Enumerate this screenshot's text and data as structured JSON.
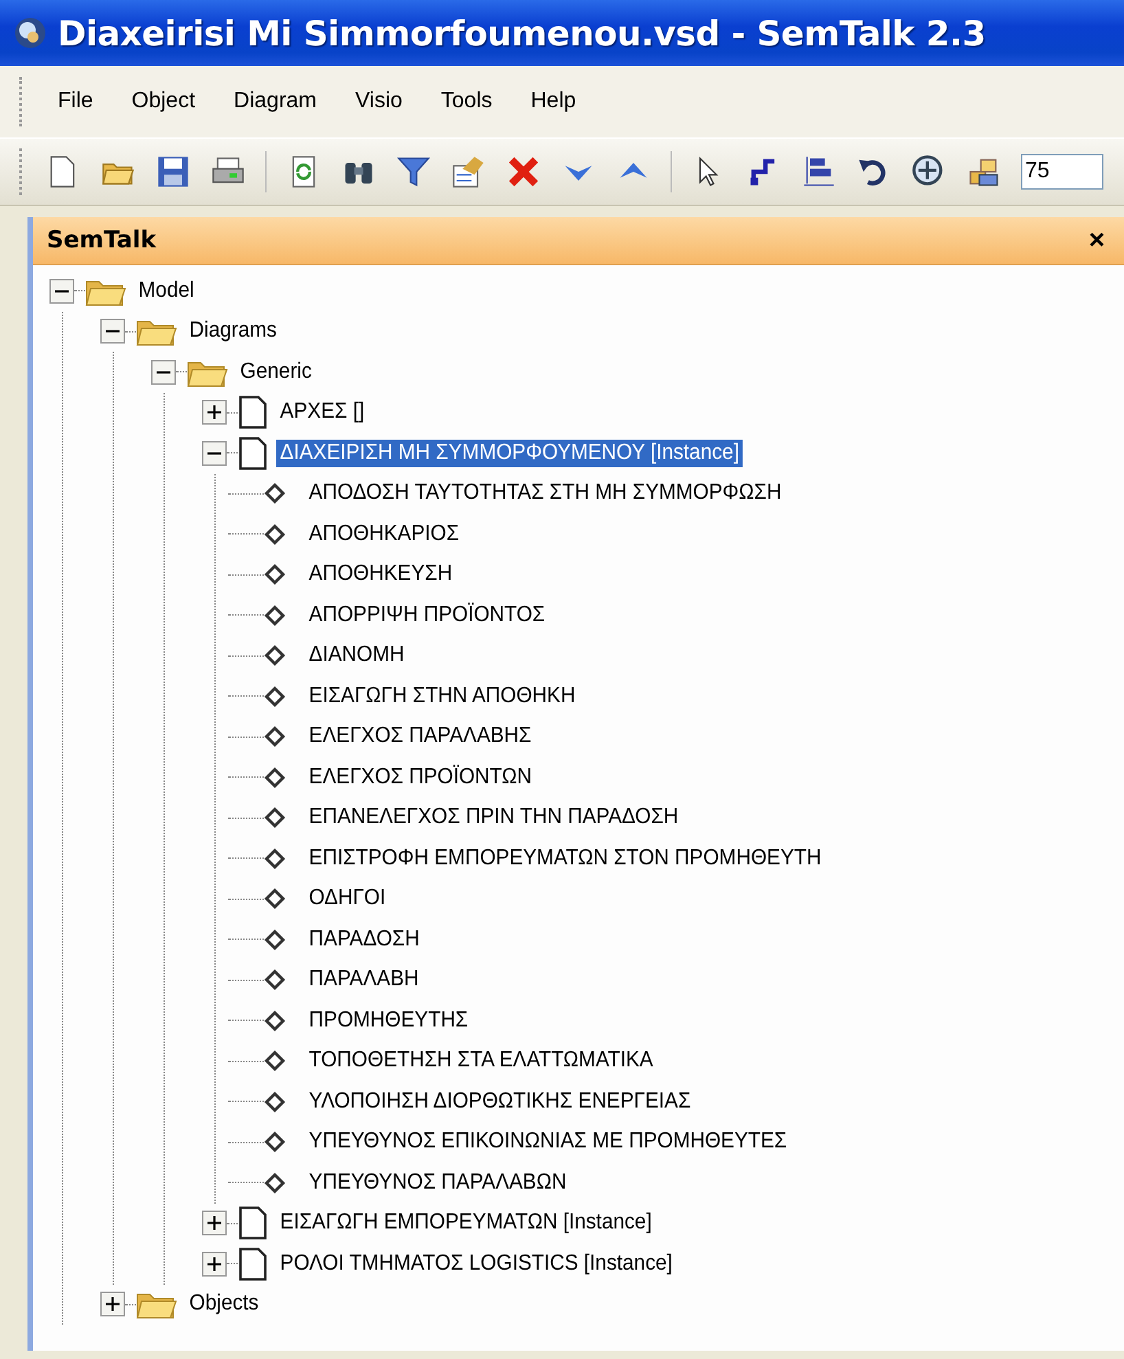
{
  "window": {
    "title": "Diaxeirisi Mi Simmorfoumenou.vsd - SemTalk 2.3"
  },
  "menu": [
    "File",
    "Object",
    "Diagram",
    "Visio",
    "Tools",
    "Help"
  ],
  "toolbar": {
    "zoom_value": "75"
  },
  "panel": {
    "title": "SemTalk",
    "close_glyph": "×"
  },
  "tree": [
    {
      "label": "Model",
      "kind": "folder",
      "expanded": true,
      "selected": false,
      "children": [
        {
          "label": "Diagrams",
          "kind": "folder",
          "expanded": true,
          "selected": false,
          "children": [
            {
              "label": "Generic",
              "kind": "folder",
              "expanded": true,
              "selected": false,
              "children": [
                {
                  "label": "ΑΡΧΕΣ []",
                  "kind": "document",
                  "expanded": false,
                  "selected": false
                },
                {
                  "label": "ΔΙΑΧΕΙΡΙΣΗ ΜΗ ΣΥΜΜΟΡΦΟΥΜΕΝΟΥ [Instance]",
                  "kind": "document",
                  "expanded": true,
                  "selected": true,
                  "children": [
                    {
                      "label": "ΑΠΟΔΟΣΗ ΤΑΥΤΟΤΗΤΑΣ ΣΤΗ ΜΗ ΣΥΜΜΟΡΦΩΣΗ",
                      "kind": "object",
                      "selected": false
                    },
                    {
                      "label": "ΑΠΟΘΗΚΑΡΙΟΣ",
                      "kind": "object",
                      "selected": false
                    },
                    {
                      "label": "ΑΠΟΘΗΚΕΥΣΗ",
                      "kind": "object",
                      "selected": false
                    },
                    {
                      "label": "ΑΠΟΡΡΙΨΗ ΠΡΟΪΟΝΤΟΣ",
                      "kind": "object",
                      "selected": false
                    },
                    {
                      "label": "ΔΙΑΝΟΜΗ",
                      "kind": "object",
                      "selected": false
                    },
                    {
                      "label": "ΕΙΣΑΓΩΓΗ ΣΤΗΝ ΑΠΟΘΗΚΗ",
                      "kind": "object",
                      "selected": false
                    },
                    {
                      "label": "ΕΛΕΓΧΟΣ ΠΑΡΑΛΑΒΗΣ",
                      "kind": "object",
                      "selected": false
                    },
                    {
                      "label": "ΕΛΕΓΧΟΣ ΠΡΟΪΟΝΤΩΝ",
                      "kind": "object",
                      "selected": false
                    },
                    {
                      "label": "ΕΠΑΝΕΛΕΓΧΟΣ ΠΡΙΝ ΤΗΝ ΠΑΡΑΔΟΣΗ",
                      "kind": "object",
                      "selected": false
                    },
                    {
                      "label": "ΕΠΙΣΤΡΟΦΗ ΕΜΠΟΡΕΥΜΑΤΩΝ ΣΤΟΝ ΠΡΟΜΗΘΕΥΤΗ",
                      "kind": "object",
                      "selected": false
                    },
                    {
                      "label": "ΟΔΗΓΟΙ",
                      "kind": "object",
                      "selected": false
                    },
                    {
                      "label": "ΠΑΡΑΔΟΣΗ",
                      "kind": "object",
                      "selected": false
                    },
                    {
                      "label": "ΠΑΡΑΛΑΒΗ",
                      "kind": "object",
                      "selected": false
                    },
                    {
                      "label": "ΠΡΟΜΗΘΕΥΤΗΣ",
                      "kind": "object",
                      "selected": false
                    },
                    {
                      "label": "ΤΟΠΟΘΕΤΗΣΗ ΣΤΑ ΕΛΑΤΤΩΜΑΤΙΚΑ",
                      "kind": "object",
                      "selected": false
                    },
                    {
                      "label": "ΥΛΟΠΟΙΗΣΗ ΔΙΟΡΘΩΤΙΚΗΣ ΕΝΕΡΓΕΙΑΣ",
                      "kind": "object",
                      "selected": false
                    },
                    {
                      "label": "ΥΠΕΥΘΥΝΟΣ ΕΠΙΚΟΙΝΩΝΙΑΣ ΜΕ ΠΡΟΜΗΘΕΥΤΕΣ",
                      "kind": "object",
                      "selected": false
                    },
                    {
                      "label": "ΥΠΕΥΘΥΝΟΣ ΠΑΡΑΛΑΒΩΝ",
                      "kind": "object",
                      "selected": false
                    }
                  ]
                },
                {
                  "label": "ΕΙΣΑΓΩΓΗ ΕΜΠΟΡΕΥΜΑΤΩΝ [Instance]",
                  "kind": "document",
                  "expanded": false,
                  "selected": false
                },
                {
                  "label": "ΡΟΛΟΙ ΤΜΗΜΑΤΟΣ LOGISTICS [Instance]",
                  "kind": "document",
                  "expanded": false,
                  "selected": false
                }
              ]
            }
          ]
        },
        {
          "label": "Objects",
          "kind": "folder",
          "expanded": false,
          "selected": false
        }
      ]
    }
  ]
}
